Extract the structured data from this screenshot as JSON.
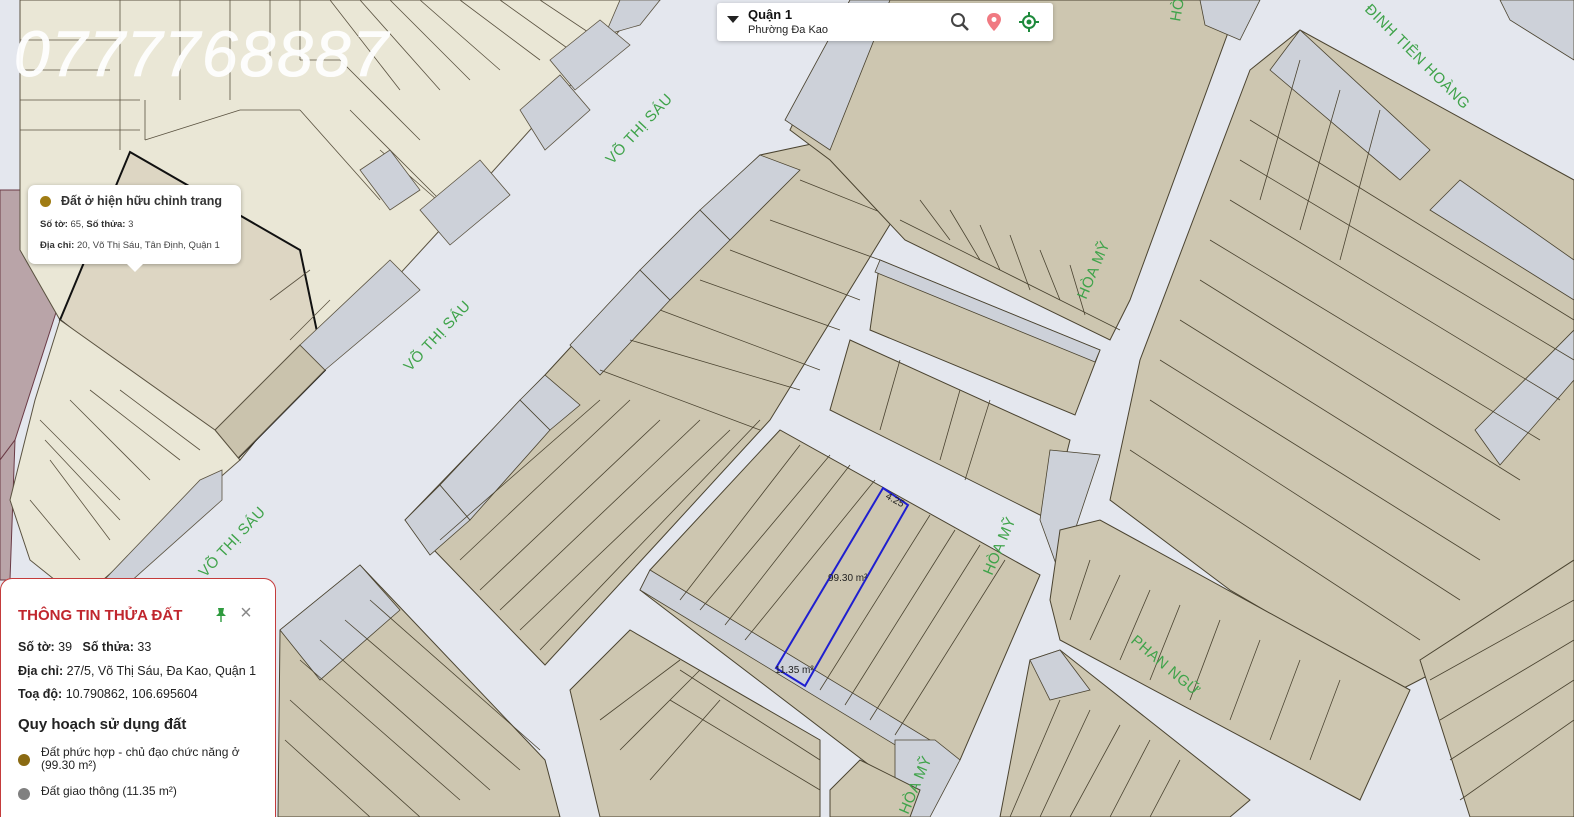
{
  "watermark": "0777768887",
  "streets": {
    "vo_thi_sau_1": "VÕ THỊ SÁU",
    "vo_thi_sau_2": "VÕ THỊ SÁU",
    "vo_thi_sau_3": "VÕ THỊ SÁU",
    "hoa_my_1": "HÒA MỸ",
    "hoa_my_2": "HÒA MỸ",
    "hoa_my_3": "HÒA MỸ",
    "hoa_my_top": "HÒ",
    "dinh_tien_hoang": "ĐINH TIÊN HOÀNG",
    "phan_ngu": "PHAN NGỮ"
  },
  "parcel": {
    "area_label": "99.30 m²",
    "width_label": "4.25",
    "bottom_label": "11.35 m²"
  },
  "colors": {
    "building": "#cdc6b0",
    "light_parcel": "#eae7d6",
    "gray_strip": "#cdd1d9",
    "road": "#e4e7ee",
    "mauve": "#b9a4a8",
    "highlight": "#1f1fd0",
    "street_text": "#3fa34a",
    "title_red": "#c0262d",
    "residential_dot": "#8a6a12",
    "traffic_dot": "#808080"
  },
  "search": {
    "district": "Quận 1",
    "ward": "Phường Đa Kao",
    "icons": [
      "dropdown-caret-icon",
      "search-icon",
      "location-pin-icon",
      "locate-target-icon"
    ]
  },
  "popup": {
    "title": "Đất ở hiện hữu chỉnh trang",
    "to_label": "Số tờ:",
    "to_value": "65",
    "thua_label": "Số thửa:",
    "thua_value": "3",
    "address_label": "Địa chỉ:",
    "address_value": "20, Võ Thị Sáu, Tân Định, Quận 1"
  },
  "info_panel": {
    "title": "THÔNG TIN THỬA ĐẤT",
    "so_to_label": "Số tờ:",
    "so_to_value": "39",
    "so_thua_label": "Số thửa:",
    "so_thua_value": "33",
    "address_label": "Địa chỉ:",
    "address_value": "27/5, Võ Thị Sáu, Đa Kao, Quận 1",
    "coords_label": "Toạ độ:",
    "coords_value": "10.790862, 106.695604",
    "section_title": "Quy hoạch sử dụng đất",
    "legend": [
      {
        "label": "Đất phức hợp - chủ đạo chức năng ở (99.30 m²)"
      },
      {
        "label": "Đất giao thông (11.35 m²)"
      }
    ]
  }
}
